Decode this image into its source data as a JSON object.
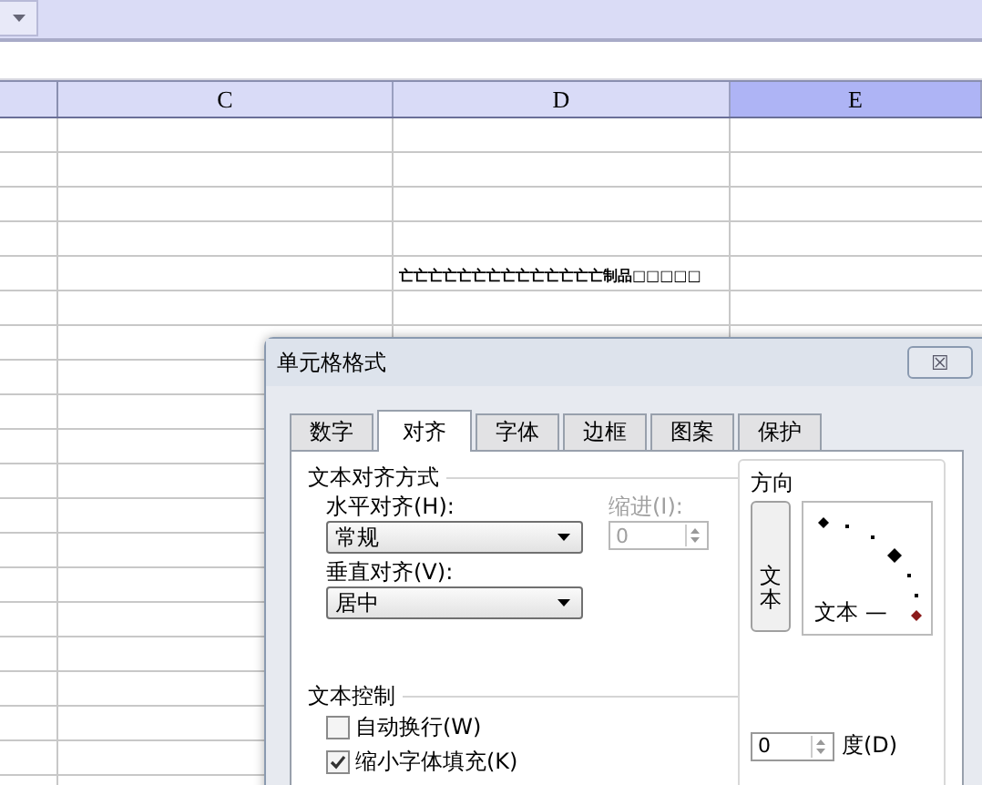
{
  "columns": [
    {
      "label": "C",
      "selected": false
    },
    {
      "label": "D",
      "selected": false
    },
    {
      "label": "E",
      "selected": true
    }
  ],
  "cell_text": "亡亡亡亡亡亡亡亡亡亡亡亡亡亡制品□□□□□",
  "dialog": {
    "title": "单元格格式",
    "close": "☒",
    "tabs": [
      {
        "label": "数字",
        "selected": false
      },
      {
        "label": "对齐",
        "selected": true
      },
      {
        "label": "字体",
        "selected": false
      },
      {
        "label": "边框",
        "selected": false
      },
      {
        "label": "图案",
        "selected": false
      },
      {
        "label": "保护",
        "selected": false
      }
    ],
    "alignment": {
      "title": "文本对齐方式",
      "horizontal_label": "水平对齐(H):",
      "horizontal_value": "常规",
      "vertical_label": "垂直对齐(V):",
      "vertical_value": "居中",
      "indent_label": "缩进(I):",
      "indent_value": "0",
      "indent_disabled": true
    },
    "orientation": {
      "title": "方向",
      "vertical_text": "文本",
      "dial_text": "文本 —",
      "degrees_value": "0",
      "degrees_label": "度(D)"
    },
    "text_control": {
      "title": "文本控制",
      "options": [
        {
          "label": "自动换行(W)",
          "checked": false
        },
        {
          "label": "缩小字体填充(K)",
          "checked": true
        }
      ]
    }
  }
}
